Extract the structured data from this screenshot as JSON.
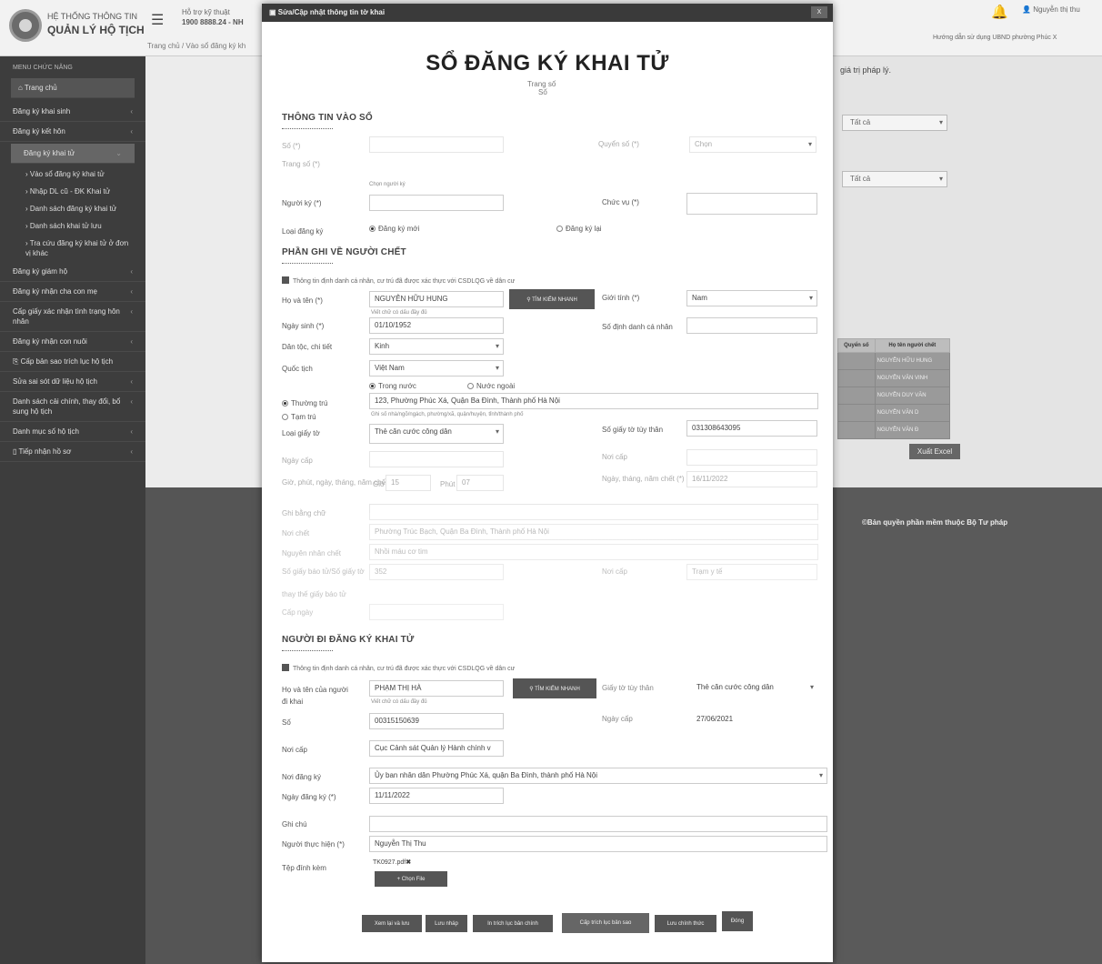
{
  "app": {
    "title_line1": "HỆ THỐNG THÔNG TIN",
    "title_line2": "QUẢN LÝ HỘ TỊCH",
    "hotline_label": "Hỗ trợ kỹ thuật",
    "hotline_number": "1900 8888.24 - NH",
    "breadcrumb": "Trang chủ / Vào sổ đăng ký kh",
    "user_name": "Nguyễn thị thu",
    "top_links": "Hướng dẫn sử dụng   UBND phường Phúc X"
  },
  "sidebar": {
    "header": "MENU CHỨC NĂNG",
    "items": [
      {
        "label": "Trang chủ"
      },
      {
        "label": "Đăng ký khai sinh"
      },
      {
        "label": "Đăng ký kết hôn"
      },
      {
        "label": "Đăng ký khai tử"
      },
      {
        "label": "Đăng ký giám hộ"
      },
      {
        "label": "Đăng ký nhận cha con mẹ"
      },
      {
        "label": "Cấp giấy xác nhận tình trạng hôn nhân"
      },
      {
        "label": "Đăng ký nhận con nuôi"
      },
      {
        "label": "Cấp bản sao trích lục hộ tịch"
      },
      {
        "label": "Sửa sai sót dữ liệu hộ tịch"
      },
      {
        "label": "Danh sách cải chính, thay đổi, bổ sung hộ tịch"
      },
      {
        "label": "Danh mục số hộ tịch"
      },
      {
        "label": "Tiếp nhận hồ sơ"
      }
    ],
    "subitems": [
      {
        "label": "Vào sổ đăng ký khai tử"
      },
      {
        "label": "Nhập DL cũ - ĐK Khai tử"
      },
      {
        "label": "Danh sách đăng ký khai tử"
      },
      {
        "label": "Danh sách khai tử lưu"
      },
      {
        "label": "Tra cứu đăng ký khai tử ở đơn vị khác"
      }
    ]
  },
  "background": {
    "legal_note": "giá trị pháp lý.",
    "select1": "Tất cả",
    "select2": "Tất cả",
    "table_headers": [
      "Quyển số",
      "Họ tên người chết"
    ],
    "table_rows": [
      "NGUYỄN HỮU HUNG",
      "NGUYỄN VĂN VINH",
      "NGUYỄN DUY VĂN",
      "NGUYỄN VĂN D",
      "NGUYỄN VĂN Đ"
    ],
    "excel_button": "Xuất Excel",
    "copyright": "©Bản quyền phần mềm thuộc Bộ Tư pháp"
  },
  "modal": {
    "header": "Sửa/Cập nhật thông tin tờ khai",
    "close": "X",
    "title": "SỔ ĐĂNG KÝ KHAI TỬ",
    "trang_so": "Trang số",
    "so": "Số",
    "sec1": "THÔNG TIN VÀO SỔ",
    "sec2": "PHẦN GHI VỀ NGƯỜI CHẾT",
    "sec3": "NGƯỜI ĐI ĐĂNG KÝ KHAI TỬ",
    "lbl_so": "Số (*)",
    "lbl_quyen_so": "Quyển số (*)",
    "quyen_so_value": "Chọn",
    "lbl_trang_so": "Trang số (*)",
    "chon_nguoi_ky": "Chọn người ký",
    "lbl_nguoi_ky": "Người ký (*)",
    "lbl_chuc_vu": "Chức vụ (*)",
    "lbl_loai_dang_ky": "Loại đăng ký",
    "opt_dk_moi": "Đăng ký mới",
    "opt_dk_lai": "Đăng ký lại",
    "verify_note": "Thông tin định danh cá nhân, cư trú đã được xác thực với CSDLQG về dân cư",
    "lbl_ho_ten": "Họ và tên (*)",
    "ho_ten": "NGUYỄN HỮU HUNG",
    "btn_search": "TÌM KIẾM NHANH",
    "hint_viet": "Viết chữ có dấu đầy đủ",
    "lbl_gioi_tinh": "Giới tính (*)",
    "gioi_tinh": "Nam",
    "lbl_ngay_sinh": "Ngày sinh (*)",
    "ngay_sinh": "01/10/1952",
    "lbl_so_dinh_danh": "Số định danh cá nhân",
    "lbl_dan_toc": "Dân tộc, chi tiết",
    "dan_toc": "Kinh",
    "lbl_quoc_tich": "Quốc tịch",
    "quoc_tich": "Việt Nam",
    "opt_trong_nuoc": "Trong nước",
    "opt_nuoc_ngoai": "Nước ngoài",
    "opt_thuong_tru": "Thường trú",
    "thuong_tru": "123, Phường Phúc Xá, Quận Ba Đình, Thành phố Hà Nội",
    "opt_tam_tru": "Tạm trú",
    "hint_diachi": "Ghi số nhà/ngõ/ngách, phường/xã, quận/huyện, tỉnh/thành phố",
    "lbl_loai_giay_to": "Loại giấy tờ",
    "loai_giay_to": "Thẻ căn cước công dân",
    "lbl_so_giay_to": "Số giấy tờ tùy thân",
    "so_giay_to": "031308643095",
    "lbl_ngay_cap": "Ngày cấp",
    "lbl_noi_cap": "Nơi cấp",
    "lbl_gio_phut": "Giờ, phút, ngày, tháng, năm chết",
    "gio_label": "Giờ",
    "gio": "15",
    "phut_label": "Phút",
    "phut": "07",
    "lbl_ngay_thang_chet": "Ngày, tháng, năm chết (*)",
    "ngay_chet": "16/11/2022",
    "lbl_ghi_bang_chu": "Ghi bằng chữ",
    "lbl_noi_chet": "Nơi chết",
    "noi_chet": "Phường Trúc Bạch, Quận Ba Đình, Thành phố Hà Nội",
    "lbl_nguyen_nhan": "Nguyên nhân chết",
    "nguyen_nhan": "Nhồi máu cơ tim",
    "lbl_so_giay_bao_tu": "Số giấy báo tử/Số giấy tờ",
    "so_giay_bao_tu": "352",
    "lbl_noi_cap2": "Nơi cấp",
    "noi_cap2": "Trạm y tế",
    "lbl_thay_the": "thay thế giấy báo tử",
    "lbl_cap_ngay": "Cấp ngày",
    "lbl_ho_ten_nguoi_di": "Họ và tên của người đi khai",
    "ho_ten_nguoi_di": "PHẠM THỊ HÀ",
    "lbl_giay_to_tuy_than": "Giấy tờ tùy thân",
    "giay_to_tuy_than": "Thẻ căn cước công dân",
    "lbl_so2": "Số",
    "so_nguoi_di": "00315150639",
    "lbl_ngay_cap2": "Ngày cấp",
    "ngay_cap2": "27/06/2021",
    "lbl_noi_cap3": "Nơi cấp",
    "noi_cap3": "Cục Cảnh sát Quản lý Hành chính v",
    "lbl_noi_dang_ky": "Nơi đăng ký",
    "noi_dang_ky": "Ủy ban nhân dân Phường Phúc Xá, quận Ba Đình, thành phố Hà Nội",
    "lbl_ngay_dang_ky": "Ngày đăng ký (*)",
    "ngay_dang_ky": "11/11/2022",
    "lbl_ghi_chu": "Ghi chú",
    "lbl_nguoi_thuc_hien": "Người thực hiện (*)",
    "nguoi_thuc_hien": "Nguyễn Thị Thu",
    "lbl_tep": "Tệp đính kèm",
    "file_name": "TK0927.pdf",
    "btn_chon_file": "Chọn File",
    "buttons": [
      "Xem lại và lưu",
      "Lưu nháp",
      "In trích lục bản chính",
      "Cấp trích lục bản sao",
      "Lưu chính thức",
      "Đóng"
    ]
  }
}
